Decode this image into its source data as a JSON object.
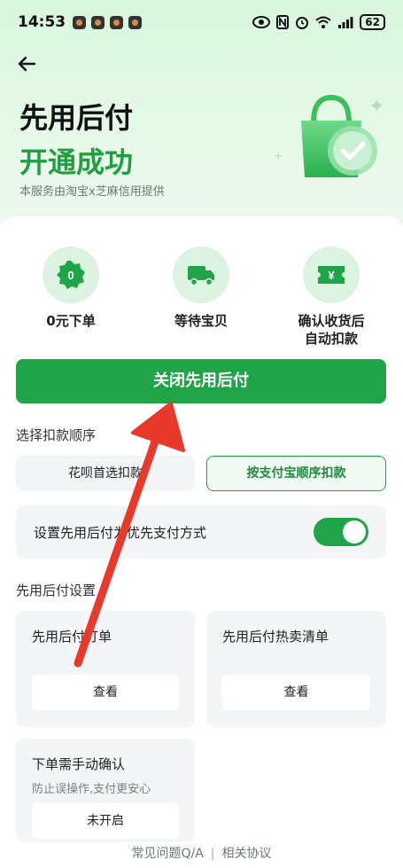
{
  "status_bar": {
    "time": "14:53",
    "battery": "62",
    "icons": [
      "eye-icon",
      "nfc-icon",
      "alarm-icon",
      "wifi-icon",
      "signal-icon"
    ]
  },
  "header": {
    "title_line1": "先用后付",
    "title_line2": "开通成功",
    "subtitle": "本服务由淘宝x芝麻信用提供"
  },
  "features": [
    {
      "label": "0元下单",
      "icon": "zero-badge-icon",
      "icon_text": "0"
    },
    {
      "label": "等待宝贝",
      "icon": "truck-icon"
    },
    {
      "label_line1": "确认收货后",
      "label_line2": "自动扣款",
      "icon": "yuan-ticket-icon",
      "icon_text": "¥"
    }
  ],
  "close_button_label": "关闭先用后付",
  "payment_order": {
    "title": "选择扣款顺序",
    "options": [
      "花呗首选扣款",
      "按支付宝顺序扣款"
    ],
    "selected": "按支付宝顺序扣款"
  },
  "preference": {
    "label": "设置先用后付为优先支付方式",
    "enabled": true
  },
  "settings": {
    "title": "先用后付设置",
    "tiles": [
      {
        "title": "先用后付订单",
        "button": "查看"
      },
      {
        "title": "先用后付热卖清单",
        "button": "查看"
      },
      {
        "title": "下单需手动确认",
        "subtitle": "防止误操作,支付更安心",
        "button": "未开启"
      }
    ]
  },
  "footer": {
    "faq": "常见问题Q/A",
    "separator": "|",
    "agreement": "相关协议"
  },
  "colors": {
    "accent": "#1fa447",
    "annotation_arrow": "#e8392b"
  }
}
